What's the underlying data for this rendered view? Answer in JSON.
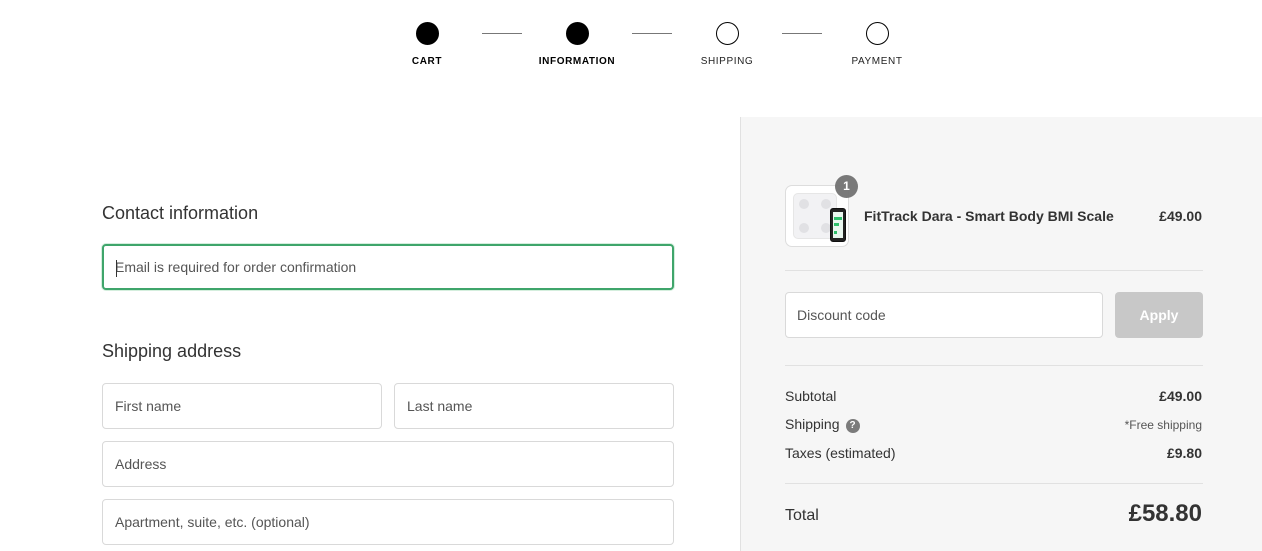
{
  "stepper": {
    "steps": [
      {
        "label": "CART",
        "state": "complete"
      },
      {
        "label": "INFORMATION",
        "state": "current"
      },
      {
        "label": "SHIPPING",
        "state": "pending"
      },
      {
        "label": "PAYMENT",
        "state": "pending"
      }
    ]
  },
  "contact": {
    "title": "Contact information",
    "email_placeholder": "Email is required for order confirmation"
  },
  "shipping": {
    "title": "Shipping address",
    "first_name_placeholder": "First name",
    "last_name_placeholder": "Last name",
    "address_placeholder": "Address",
    "apartment_placeholder": "Apartment, suite, etc. (optional)"
  },
  "summary": {
    "product": {
      "name": "FitTrack Dara - Smart Body BMI Scale",
      "price": "£49.00",
      "quantity": "1",
      "image_icon": "scale-product-image"
    },
    "discount": {
      "placeholder": "Discount code",
      "apply_label": "Apply"
    },
    "subtotal_label": "Subtotal",
    "subtotal_value": "£49.00",
    "shipping_label": "Shipping",
    "shipping_help": "?",
    "shipping_value": "*Free shipping",
    "taxes_label": "Taxes (estimated)",
    "taxes_value": "£9.80",
    "total_label": "Total",
    "total_value": "£58.80"
  },
  "colors": {
    "focus_border": "#3fa56b",
    "apply_disabled": "#c8c8c8",
    "sidebar_bg": "#f6f6f6"
  }
}
